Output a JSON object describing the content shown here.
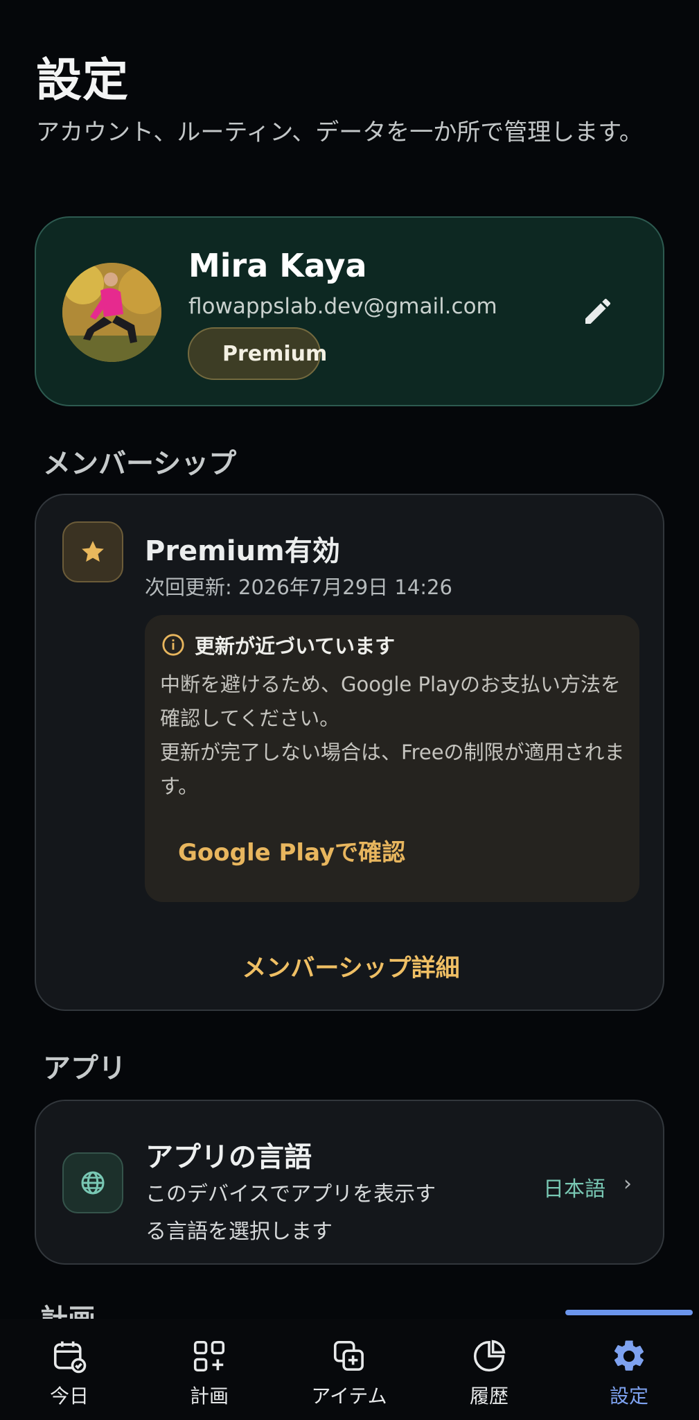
{
  "header": {
    "title": "設定",
    "subtitle": "アカウント、ルーティン、データを一か所で管理します。"
  },
  "profile": {
    "name": "Mira Kaya",
    "email": "flowappslab.dev@gmail.com",
    "badge": "Premium",
    "edit_icon": "pencil-icon"
  },
  "membership": {
    "section_label": "メンバーシップ",
    "status_title": "Premium有効",
    "renewal": "次回更新: 2026年7月29日 14:26",
    "notice": {
      "title": "更新が近づいています",
      "body_line1": "中断を避けるため、Google Playのお支払い方法を確認してください。",
      "body_line2": "更新が完了しない場合は、Freeの制限が適用されます。",
      "link": "Google Playで確認"
    },
    "details_link": "メンバーシップ詳細"
  },
  "app_section": {
    "section_label": "アプリ",
    "language": {
      "title": "アプリの言語",
      "description": "このデバイスでアプリを表示する言語を選択します",
      "value": "日本語",
      "chevron": "›"
    }
  },
  "next_section_partial": "計画",
  "nav": {
    "items": [
      {
        "label": "今日",
        "icon": "calendar-check-icon"
      },
      {
        "label": "計画",
        "icon": "grid-plus-icon"
      },
      {
        "label": "アイテム",
        "icon": "copy-plus-icon"
      },
      {
        "label": "履歴",
        "icon": "pie-chart-icon"
      },
      {
        "label": "設定",
        "icon": "gear-icon"
      }
    ],
    "active_index": 4
  },
  "colors": {
    "accent_gold": "#efbf64",
    "accent_teal": "#79c8b4",
    "nav_active": "#7ea2f0",
    "background": "#05070a"
  }
}
